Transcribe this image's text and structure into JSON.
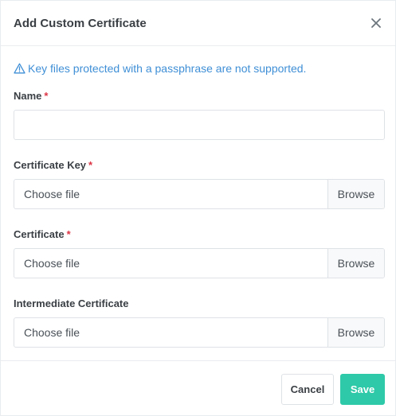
{
  "modal": {
    "title": "Add Custom Certificate",
    "close_icon": "close-icon"
  },
  "notice": {
    "icon": "warning-triangle-icon",
    "text": "Key files protected with a passphrase are not supported.",
    "color": "#3f8fd6"
  },
  "fields": {
    "name": {
      "label": "Name",
      "required_mark": "*",
      "value": ""
    },
    "certificate_key": {
      "label": "Certificate Key",
      "required_mark": "*",
      "file_text": "Choose file",
      "browse_label": "Browse"
    },
    "certificate": {
      "label": "Certificate",
      "required_mark": "*",
      "file_text": "Choose file",
      "browse_label": "Browse"
    },
    "intermediate_certificate": {
      "label": "Intermediate Certificate",
      "file_text": "Choose file",
      "browse_label": "Browse"
    }
  },
  "footer": {
    "cancel_label": "Cancel",
    "save_label": "Save"
  },
  "colors": {
    "primary": "#2ec9a8",
    "required": "#dc3545",
    "info": "#3f8fd6"
  }
}
